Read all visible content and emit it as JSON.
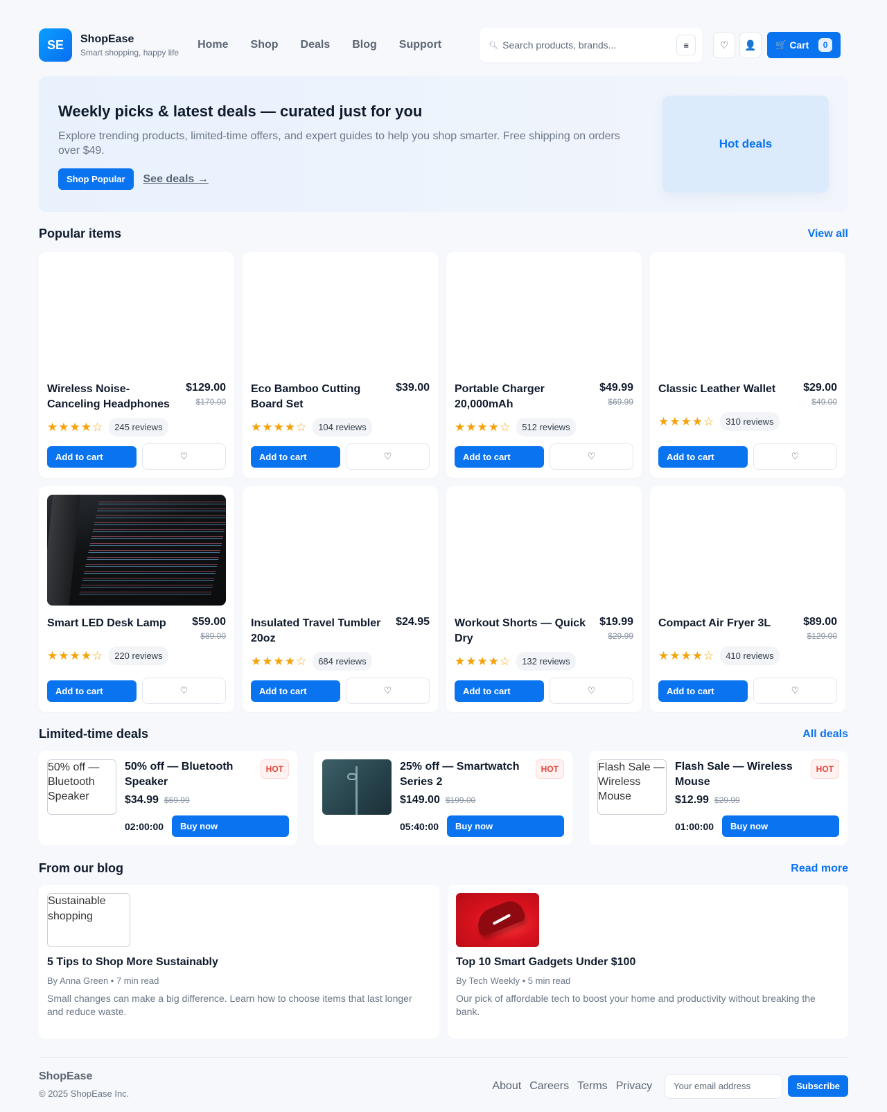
{
  "header": {
    "logo_initials": "SE",
    "brand_name": "ShopEase",
    "tagline": "Smart shopping, happy life",
    "nav": [
      "Home",
      "Shop",
      "Deals",
      "Blog",
      "Support"
    ],
    "search_placeholder": "Search products, brands...",
    "search_icon": "search-icon",
    "filter_icon": "≡",
    "wishlist_icon": "♡",
    "account_icon": "👤",
    "cart_icon": "🛒",
    "cart_label": "Cart",
    "cart_count": "0"
  },
  "hero": {
    "title": "Weekly picks & latest deals — curated just for you",
    "subtitle": "Explore trending products, limited-time offers, and expert guides to help you shop smarter. Free shipping on orders over $49.",
    "primary_cta": "Shop Popular",
    "secondary_cta": "See deals →",
    "side_card": "Hot deals"
  },
  "popular": {
    "title": "Popular items",
    "view_all": "View all",
    "add_label": "Add to cart",
    "wish_icon": "♡",
    "items": [
      {
        "name": "Wireless Noise-Canceling Headphones",
        "price": "$129.00",
        "old_price": "$179.00",
        "stars": "★★★★☆",
        "reviews": "245 reviews",
        "rating": 4
      },
      {
        "name": "Eco Bamboo Cutting Board Set",
        "price": "$39.00",
        "old_price": "",
        "stars": "★★★★☆",
        "reviews": "104 reviews",
        "rating": 4
      },
      {
        "name": "Portable Charger 20,000mAh",
        "price": "$49.99",
        "old_price": "$69.99",
        "stars": "★★★★☆",
        "reviews": "512 reviews",
        "rating": 4
      },
      {
        "name": "Classic Leather Wallet",
        "price": "$29.00",
        "old_price": "$49.00",
        "stars": "★★★★☆",
        "reviews": "310 reviews",
        "rating": 4
      },
      {
        "name": "Smart LED Desk Lamp",
        "price": "$59.00",
        "old_price": "$89.00",
        "stars": "★★★★☆",
        "reviews": "220 reviews",
        "rating": 4
      },
      {
        "name": "Insulated Travel Tumbler 20oz",
        "price": "$24.95",
        "old_price": "",
        "stars": "★★★★☆",
        "reviews": "684 reviews",
        "rating": 4
      },
      {
        "name": "Workout Shorts — Quick Dry",
        "price": "$19.99",
        "old_price": "$29.99",
        "stars": "★★★★☆",
        "reviews": "132 reviews",
        "rating": 4
      },
      {
        "name": "Compact Air Fryer 3L",
        "price": "$89.00",
        "old_price": "$129.00",
        "stars": "★★★★☆",
        "reviews": "410 reviews",
        "rating": 4
      }
    ]
  },
  "deals": {
    "title": "Limited-time deals",
    "all_link": "All deals",
    "badge": "HOT",
    "buy_label": "Buy now",
    "items": [
      {
        "img_alt": "50% off — Bluetooth Speaker",
        "title": "50% off — Bluetooth Speaker",
        "price": "$34.99",
        "old_price": "$69.99",
        "timer": "02:00:00"
      },
      {
        "img_alt": "",
        "title": "25% off — Smartwatch Series 2",
        "price": "$149.00",
        "old_price": "$199.00",
        "timer": "05:40:00"
      },
      {
        "img_alt": "Flash Sale — Wireless Mouse",
        "title": "Flash Sale — Wireless Mouse",
        "price": "$12.99",
        "old_price": "$29.99",
        "timer": "01:00:00"
      }
    ]
  },
  "blog": {
    "title": "From our blog",
    "read_more": "Read more",
    "posts": [
      {
        "img_alt": "Sustainable shopping",
        "title": "5 Tips to Shop More Sustainably",
        "meta": "By Anna Green • 7 min read",
        "desc": "Small changes can make a big difference. Learn how to choose items that last longer and reduce waste."
      },
      {
        "img_alt": "",
        "title": "Top 10 Smart Gadgets Under $100",
        "meta": "By Tech Weekly • 5 min read",
        "desc": "Our pick of affordable tech to boost your home and productivity without breaking the bank."
      }
    ]
  },
  "footer": {
    "brand": "ShopEase",
    "copyright": "© 2025 ShopEase Inc.",
    "links": [
      "About",
      "Careers",
      "Terms",
      "Privacy"
    ],
    "email_placeholder": "Your email address",
    "subscribe": "Subscribe"
  },
  "colors": {
    "accent": "#0a73f0",
    "star": "#f5a20a",
    "hot": "#e0463c"
  }
}
